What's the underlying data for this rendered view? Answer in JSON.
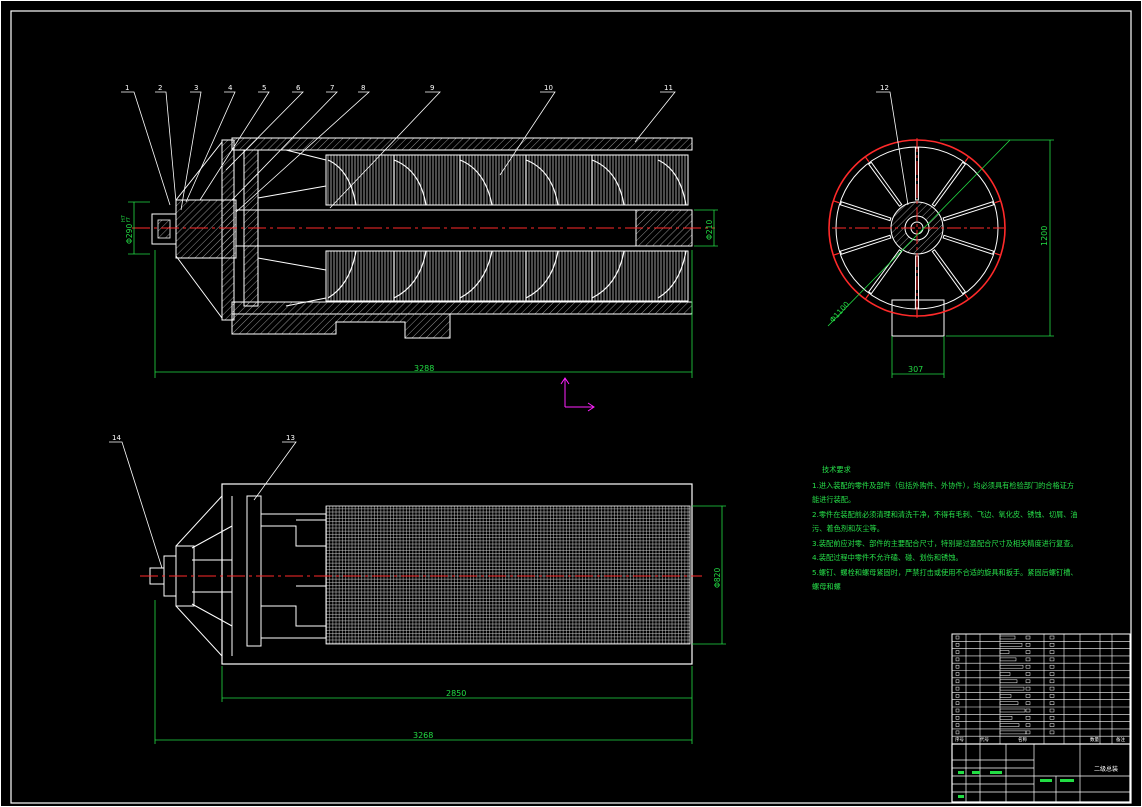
{
  "drawing": {
    "view_front": {
      "balloons": [
        "1",
        "2",
        "3",
        "4",
        "5",
        "6",
        "7",
        "8",
        "9",
        "10",
        "11"
      ],
      "dimensions": {
        "diameter_left": "Φ290",
        "tolerance_sup": "H7",
        "tolerance_sub": "f7",
        "diameter_right": "Φ210",
        "length": "3288"
      }
    },
    "view_side": {
      "balloon": "12",
      "dimensions": {
        "height": "1200",
        "diameter": "Φ1100",
        "width": "307"
      }
    },
    "view_top": {
      "balloons": [
        "14",
        "13"
      ],
      "dimensions": {
        "diameter": "Φ820",
        "length_inner": "2850",
        "length_total": "3268"
      }
    }
  },
  "technical_requirements": {
    "title": "技术要求",
    "lines": [
      "1.进入装配的零件及部件（包括外购件、外协件），均必须具有检验部门的合格证方",
      "能进行装配。",
      "2.零件在装配前必须清理和清洗干净，不得有毛刺、飞边、氧化皮、锈蚀、切屑、油",
      "污、着色剂和灰尘等。",
      "3.装配前应对零、部件的主要配合尺寸，特别是过盈配合尺寸及相关精度进行复查。",
      "4.装配过程中零件不允许磕、碰、划伤和锈蚀。",
      "5.螺钉、螺栓和螺母紧固时，严禁打击或使用不合适的旋具和扳手。紧固后螺钉槽、",
      "螺母和螺"
    ]
  },
  "title_block": {
    "drawing_name": "二级总装",
    "row_headers": [
      "序号",
      "代号",
      "名称",
      "数量",
      "备注"
    ]
  },
  "colors": {
    "outline": "#ffffff",
    "dimension": "#22dd44",
    "centerline": "#ff2a2a",
    "leader": "#ffffff",
    "ucs": "#ff22ff",
    "hatch": "#aaaaaa"
  }
}
